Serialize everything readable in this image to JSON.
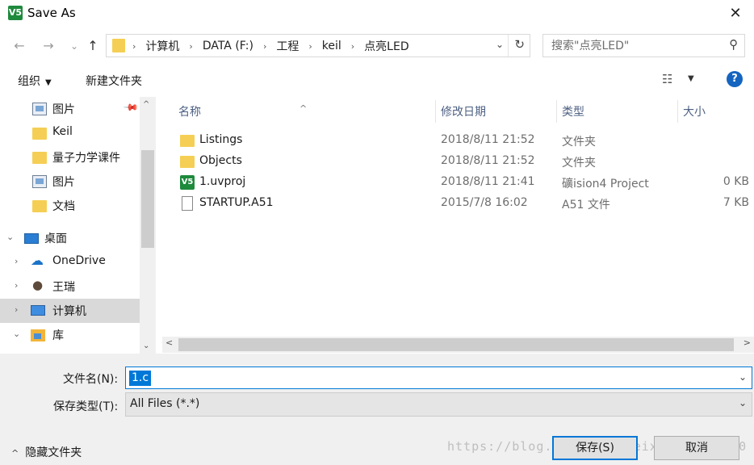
{
  "window": {
    "title": "Save As",
    "app_icon_text": "V5",
    "close_glyph": "✕"
  },
  "navigation": {
    "back_glyph": "←",
    "forward_glyph": "→",
    "recent_glyph": "⌄",
    "up_glyph": "↑"
  },
  "address_bar": {
    "crumbs": [
      "计算机",
      "DATA (F:)",
      "工程",
      "keil",
      "点亮LED"
    ],
    "separator": "›",
    "dropdown_glyph": "⌄",
    "refresh_glyph": "↻"
  },
  "search": {
    "placeholder": "搜索\"点亮LED\"",
    "icon_glyph": "⚲"
  },
  "toolbar": {
    "organize_label": "组织",
    "organize_caret": "▼",
    "new_folder_label": "新建文件夹",
    "view_glyph": "☷",
    "view_caret": "▼",
    "help_glyph": "?"
  },
  "nav_pane": {
    "items": [
      {
        "label": "图片",
        "icon": "pictures-icon"
      },
      {
        "label": "Keil",
        "icon": "folder-icon"
      },
      {
        "label": "量子力学课件",
        "icon": "folder-icon"
      },
      {
        "label": "图片",
        "icon": "pictures-icon"
      },
      {
        "label": "文档",
        "icon": "folder-icon"
      },
      {
        "label": "桌面",
        "icon": "desktop-icon"
      },
      {
        "label": "OneDrive",
        "icon": "onedrive-icon"
      },
      {
        "label": "王瑞",
        "icon": "user-icon"
      },
      {
        "label": "计算机",
        "icon": "computer-icon"
      },
      {
        "label": "库",
        "icon": "library-icon"
      }
    ],
    "pin_glyph": "📌",
    "chevron_right": "›",
    "chevron_down": "⌄"
  },
  "file_list": {
    "columns": {
      "name": "名称",
      "date": "修改日期",
      "type": "类型",
      "size": "大小"
    },
    "sort_glyph": "^",
    "rows": [
      {
        "name": "Listings",
        "date": "2018/8/11 21:52",
        "type": "文件夹",
        "size": "",
        "icon": "folder-icon"
      },
      {
        "name": "Objects",
        "date": "2018/8/11 21:52",
        "type": "文件夹",
        "size": "",
        "icon": "folder-icon"
      },
      {
        "name": "1.uvproj",
        "date": "2018/8/11 21:41",
        "type": "礦ision4 Project",
        "size": "0 KB",
        "icon": "uvision-icon"
      },
      {
        "name": "STARTUP.A51",
        "date": "2015/7/8 16:02",
        "type": "A51 文件",
        "size": "7 KB",
        "icon": "document-icon"
      }
    ]
  },
  "scroll": {
    "up_glyph": "^",
    "down_glyph": "⌄",
    "left_glyph": "<",
    "right_glyph": ">"
  },
  "save_panel": {
    "filename_label": "文件名(N):",
    "filename_value": "1.c",
    "filetype_label": "保存类型(T):",
    "filetype_value": "All Files (*.*)",
    "dropdown_glyph": "⌄",
    "hide_folders_caret": "^",
    "hide_folders_label": "隐藏文件夹",
    "save_label": "保存(S)",
    "cancel_label": "取消"
  },
  "watermark": "https://blog.csdn.net/weixin_41221200",
  "colors": {
    "accent": "#0078d7",
    "folder": "#f5cf55",
    "help": "#1565c0",
    "uvision": "#1e8a3c"
  }
}
